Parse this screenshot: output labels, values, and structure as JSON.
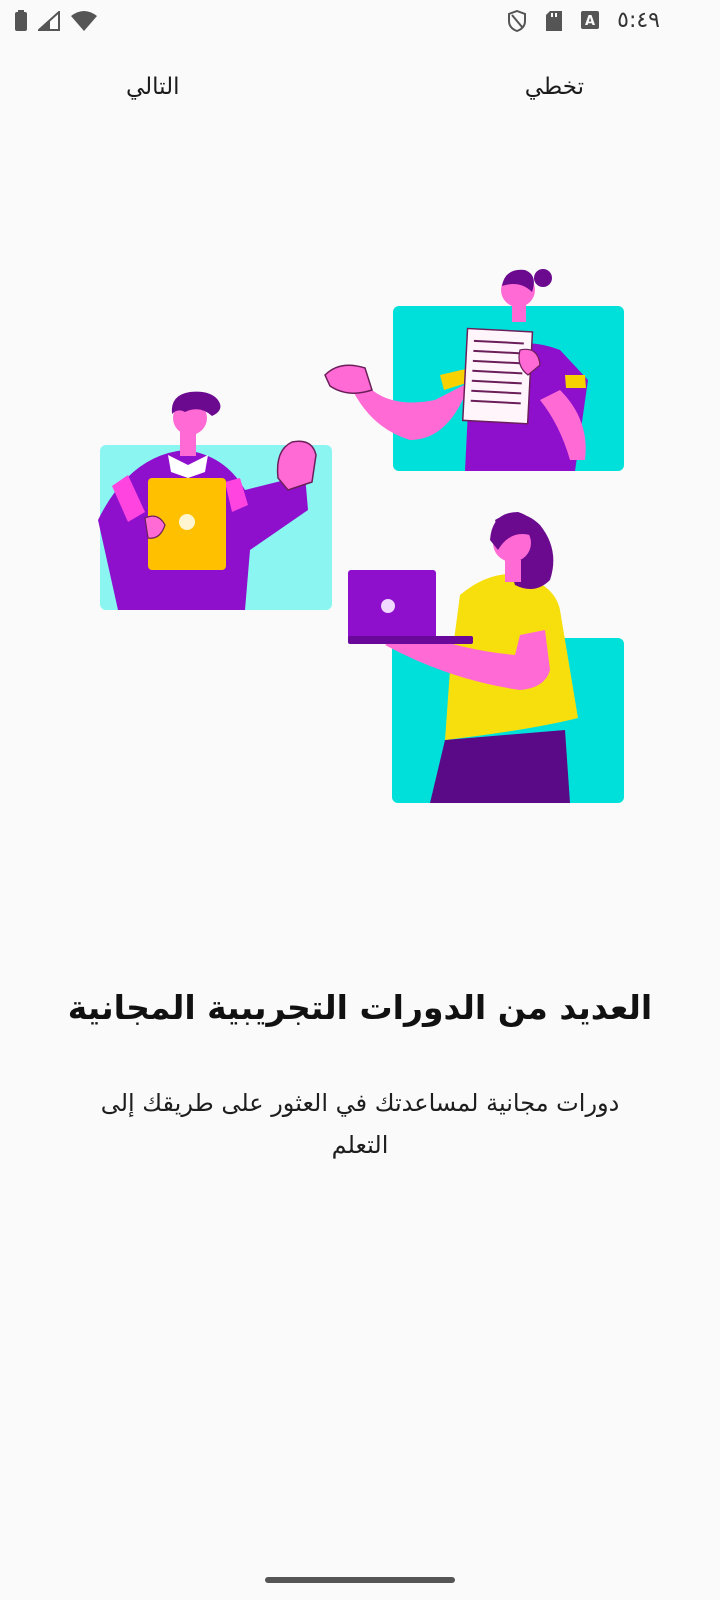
{
  "status_bar": {
    "time": "٥:٤٩",
    "icons": [
      "battery-icon",
      "signal-icon",
      "wifi-icon",
      "shield-icon",
      "sd-card-icon",
      "keyboard-a-icon"
    ]
  },
  "nav": {
    "next_label": "التالي",
    "skip_label": "تخطي"
  },
  "content": {
    "title": "العديد من الدورات التجريبية المجانية",
    "subtitle": "دورات مجانية لمساعدتك في العثور على طريقك إلى التعلم"
  },
  "colors": {
    "background": "#fafafa",
    "cyan": "#00e0db",
    "light_cyan": "#8bf5f2",
    "purple": "#8e0fcc",
    "pink": "#ff6ad5",
    "yellow": "#f7df0e",
    "amber": "#ffc000"
  }
}
